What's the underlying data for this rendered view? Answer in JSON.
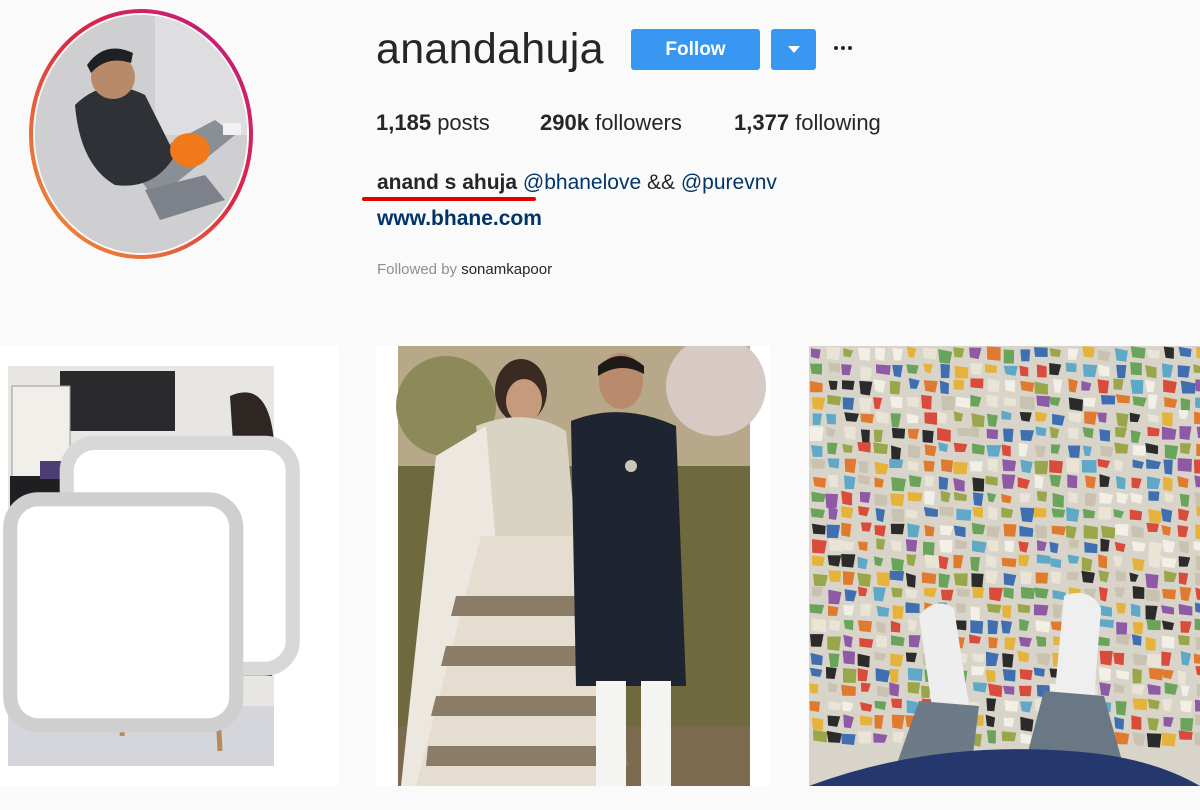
{
  "profile": {
    "username": "anandahuja",
    "follow_label": "Follow",
    "stats": {
      "posts_count": "1,185",
      "posts_label": "posts",
      "followers_count": "290k",
      "followers_label": "followers",
      "following_count": "1,377",
      "following_label": "following"
    },
    "bio": {
      "full_name": "anand s ahuja",
      "mention_1": "@bhanelove",
      "separator": "&&",
      "mention_2": "@purevnv"
    },
    "website": "www.bhane.com",
    "followed_by_prefix": "Followed by",
    "followed_by_user": "sonamkapoor"
  },
  "colors": {
    "accent_blue": "#3897f0",
    "link_blue": "#003569",
    "annotation_red": "#e00000",
    "background": "#fafafa"
  },
  "icons": {
    "dropdown": "chevron-down-icon",
    "more": "more-options-icon",
    "carousel": "multiple-photos-icon"
  },
  "posts": [
    {
      "kind": "photo",
      "has_multiple": true
    },
    {
      "kind": "photo",
      "has_multiple": false
    },
    {
      "kind": "photo",
      "has_multiple": false
    }
  ]
}
